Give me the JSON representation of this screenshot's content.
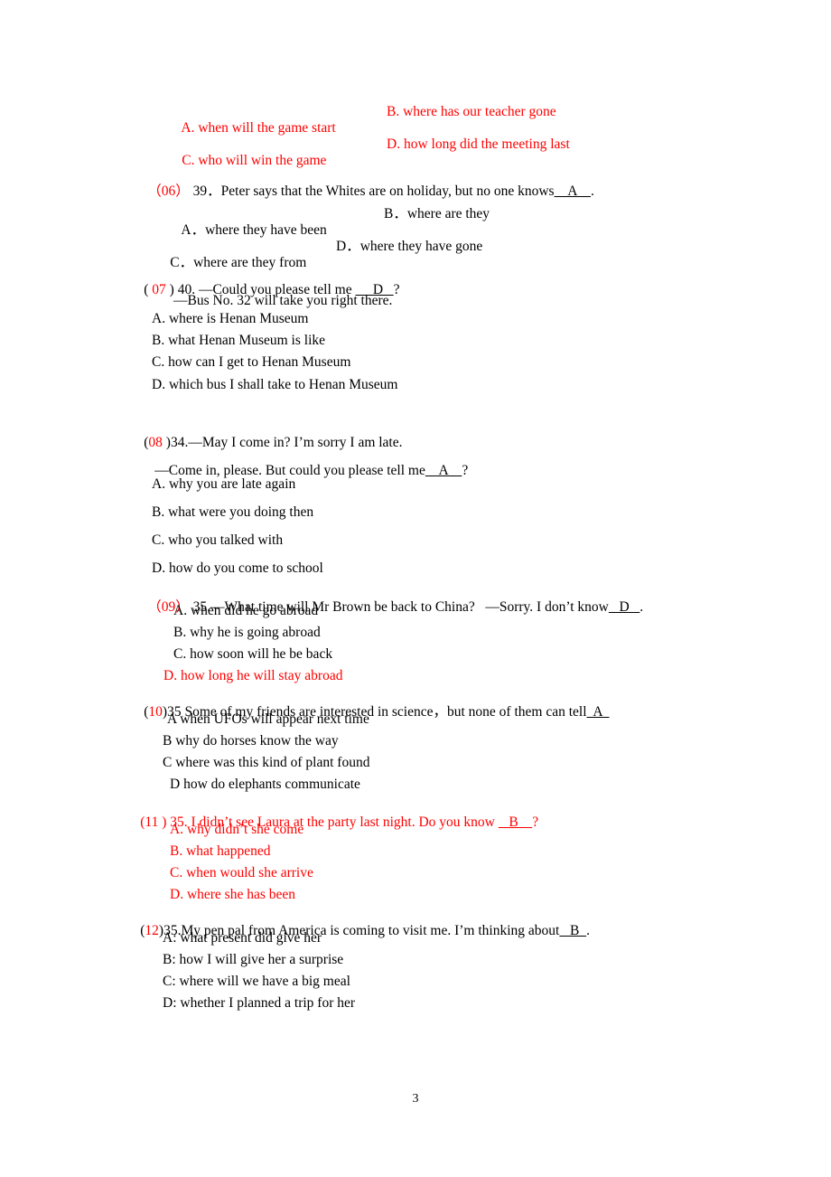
{
  "document": {
    "page_number": "3",
    "colors": {
      "answer_red": "#ff0000",
      "body_black": "#000000"
    }
  },
  "top_options": {
    "row1": {
      "a": "A. when will the game start",
      "b": "B. where has our teacher gone"
    },
    "row2": {
      "c": "C. who will win the game",
      "d": "D. how long did the meeting last"
    }
  },
  "questions": [
    {
      "num_label": "（06）",
      "stem_before": " 39．Peter says that the Whites are on holiday, but no one knows",
      "blank": "    A    ",
      "stem_after": ".",
      "options_row1": {
        "a": "A．where they have been",
        "b": "B．where are they"
      },
      "options_row2": {
        "c": "C．where are they from",
        "d": "D．where they have gone"
      }
    },
    {
      "num_label": "( 07 )",
      "stem_before": " 40. —Could you please tell me ",
      "blank": "     D   ",
      "stem_after": "?",
      "second_line": "—Bus No. 32 will take you right there.",
      "options": [
        "A. where is Henan Museum",
        "B. what Henan Museum is like",
        "C. how can I get to Henan Museum",
        "D. which bus I shall take to Henan Museum"
      ]
    },
    {
      "num_label": "(08 )",
      "stem_before": "34.—May I come in? I’m sorry I am late.",
      "second_line_before": "—Come in, please. But could you please tell me",
      "blank": "    A    ",
      "second_line_after": "?",
      "options": [
        "A. why you are late again",
        "B. what were you doing then",
        "C. who you talked with",
        "D. how do you come to school"
      ]
    },
    {
      "num_label": "（09）",
      "stem_before": " 35.—What time will Mr Brown be back to China?   —Sorry. I don’t know",
      "blank": "   D   ",
      "stem_after": ".",
      "options": [
        "A. when did he go abroad",
        "B. why he is going abroad",
        "C. how soon will he be back",
        "D. how long he will stay abroad"
      ],
      "red_option_index": 3
    },
    {
      "num_label": "(10)",
      "stem_before": "35 Some of my friends are interested in science，but none of them can tell",
      "blank": "  A  ",
      "stem_after": "",
      "options": [
        "A when UFOs will appear next time",
        "B why do horses know the way",
        "C where was this kind of plant found",
        "D how do elephants communicate"
      ]
    },
    {
      "num_label": "(11 )",
      "stem_before": " 35. I didn’t see Laura at the party last night. Do you know ",
      "blank": "   B    ",
      "stem_after": "?",
      "options": [
        "A. why didn’t she come",
        "B. what happened",
        "C. when would she arrive",
        "D. where she has been"
      ],
      "all_red": true
    },
    {
      "num_label": "(12)",
      "stem_before": "35.My pen pal from America is coming to visit me. I’m thinking about",
      "blank": "   B  ",
      "stem_after": ".",
      "options": [
        "A: what present did give her",
        "B: how I will give her a surprise",
        "C: where will we have a big meal",
        "D: whether I planned a trip for her"
      ]
    }
  ]
}
